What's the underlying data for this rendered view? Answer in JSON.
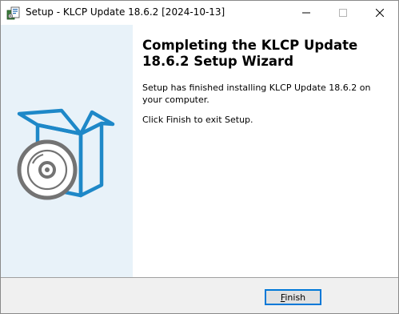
{
  "window": {
    "title": "Setup - KLCP Update 18.6.2 [2024-10-13]",
    "icons": {
      "app": "setup-installer-icon",
      "minimize": "minimize-icon",
      "maximize": "maximize-icon",
      "close": "close-icon"
    }
  },
  "banner": {
    "image": "open-box-with-disc-illustration",
    "colors": {
      "background": "#e8f2f9",
      "accent": "#1e88c8",
      "disc": "#737373"
    }
  },
  "content": {
    "heading": "Completing the KLCP Update 18.6.2 Setup Wizard",
    "message": "Setup has finished installing KLCP Update 18.6.2 on your computer.",
    "instruction": "Click Finish to exit Setup."
  },
  "footer": {
    "finish_label_access": "F",
    "finish_label_rest": "inish",
    "accent": "#0078d7"
  }
}
